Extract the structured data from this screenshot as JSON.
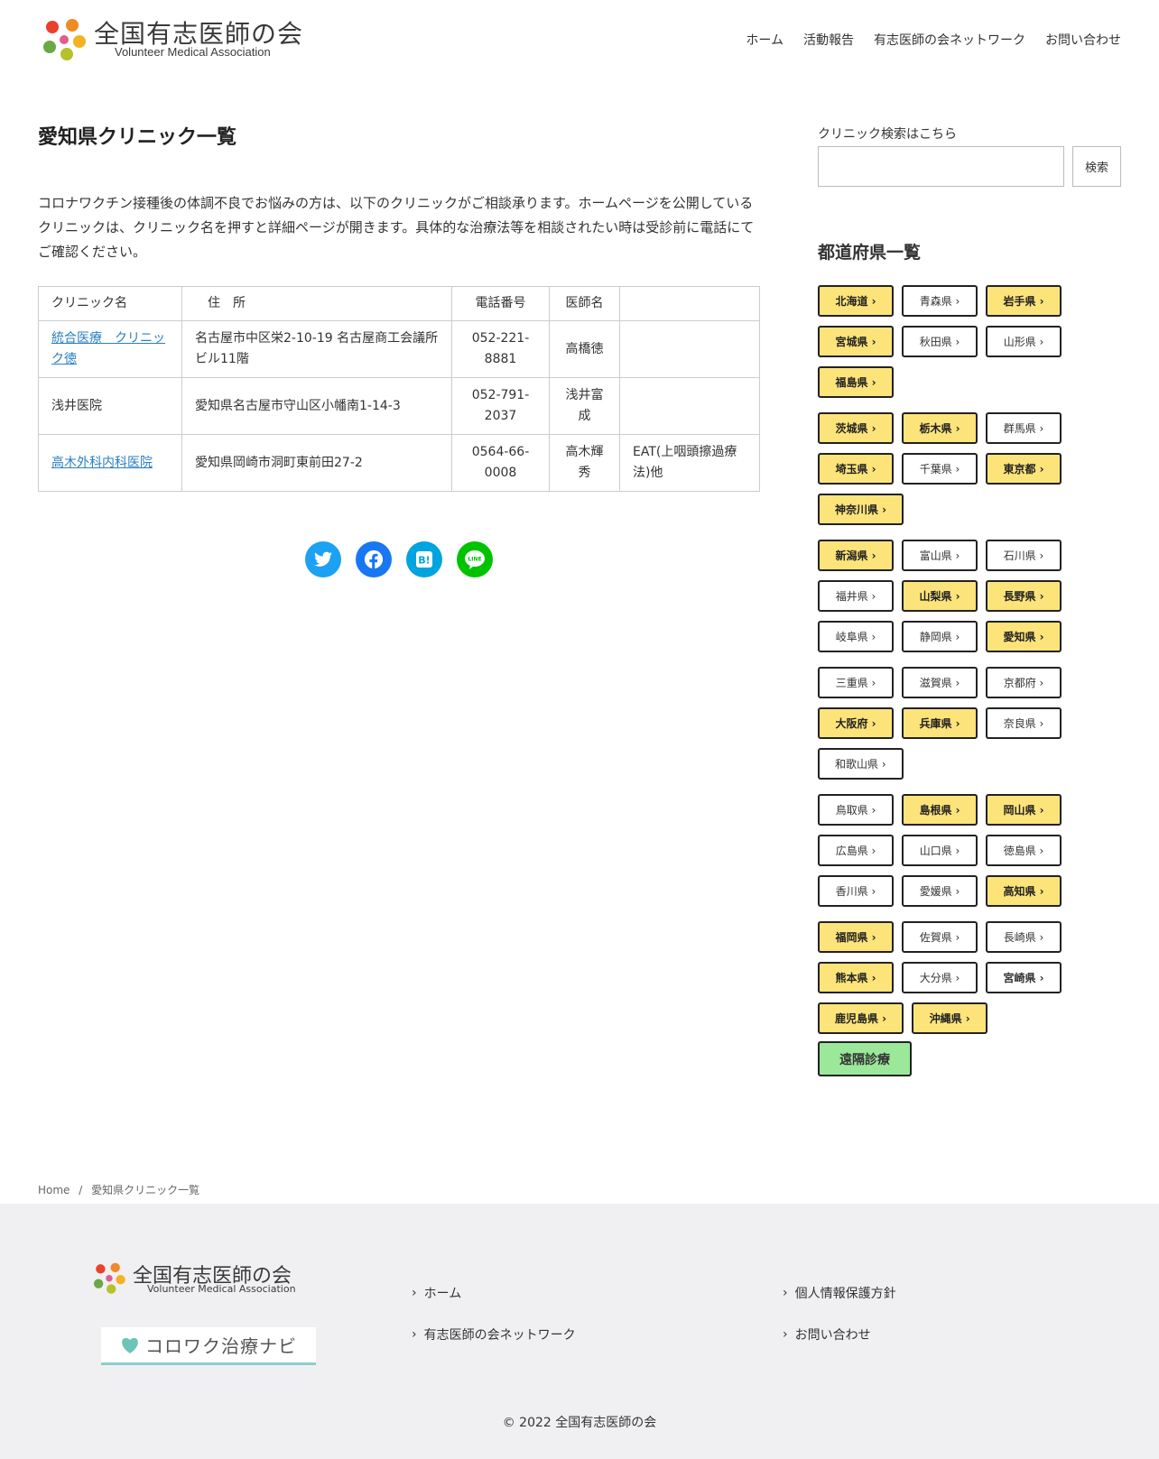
{
  "header": {
    "logo_ja": "全国有志医師の会",
    "logo_en": "Volunteer Medical Association",
    "nav": [
      "ホーム",
      "活動報告",
      "有志医師の会ネットワーク",
      "お問い合わせ"
    ]
  },
  "main": {
    "title": "愛知県クリニック一覧",
    "intro": "コロナワクチン接種後の体調不良でお悩みの方は、以下のクリニックがご相談承ります。ホームページを公開しているクリニックは、クリニック名を押すと詳細ページが開きます。具体的な治療法等を相談されたい時は受診前に電話にてご確認ください。",
    "table": {
      "headers": [
        "クリニック名",
        "住　所",
        "電話番号",
        "医師名",
        ""
      ],
      "rows": [
        {
          "name": "統合医療　クリニック徳",
          "link": true,
          "address": "名古屋市中区栄2-10-19 名古屋商工会議所ビル11階",
          "phone": "052-221-8881",
          "doctor": "高橋徳",
          "note": ""
        },
        {
          "name": "浅井医院",
          "link": false,
          "address": "愛知県名古屋市守山区小幡南1-14-3",
          "phone": "052-791-2037",
          "doctor": "浅井富成",
          "note": ""
        },
        {
          "name": "高木外科内科医院",
          "link": true,
          "address": "愛知県岡崎市洞町東前田27-2",
          "phone": "0564-66-0008",
          "doctor": "高木輝秀",
          "note": "EAT(上咽頭擦過療法)他"
        }
      ]
    },
    "share": [
      {
        "icon": "twitter-icon",
        "color": "#1da1f2"
      },
      {
        "icon": "facebook-icon",
        "color": "#1877f2"
      },
      {
        "icon": "hatena-bookmark-icon",
        "color": "#00a4de"
      },
      {
        "icon": "line-icon",
        "color": "#00c300"
      }
    ]
  },
  "sidebar": {
    "search_label": "クリニック検索はこちら",
    "search_button": "検索",
    "pref_title": "都道府県一覧",
    "groups": [
      [
        {
          "label": "北海道 ›",
          "hl": true
        },
        {
          "label": "青森県 ›",
          "hl": false
        },
        {
          "label": "岩手県 ›",
          "hl": true
        },
        {
          "label": "宮城県 ›",
          "hl": true
        },
        {
          "label": "秋田県 ›",
          "hl": false
        },
        {
          "label": "山形県 ›",
          "hl": false
        },
        {
          "label": "福島県 ›",
          "hl": true
        }
      ],
      [
        {
          "label": "茨城県 ›",
          "hl": true
        },
        {
          "label": "栃木県 ›",
          "hl": true
        },
        {
          "label": "群馬県 ›",
          "hl": false
        },
        {
          "label": "埼玉県 ›",
          "hl": true
        },
        {
          "label": "千葉県 ›",
          "hl": false
        },
        {
          "label": "東京都 ›",
          "hl": true
        },
        {
          "label": "神奈川県 ›",
          "hl": true
        }
      ],
      [
        {
          "label": "新潟県 ›",
          "hl": true
        },
        {
          "label": "富山県 ›",
          "hl": false
        },
        {
          "label": "石川県 ›",
          "hl": false
        },
        {
          "label": "福井県 ›",
          "hl": false
        },
        {
          "label": "山梨県 ›",
          "hl": true
        },
        {
          "label": "長野県 ›",
          "hl": true
        },
        {
          "label": "岐阜県 ›",
          "hl": false
        },
        {
          "label": "静岡県 ›",
          "hl": false
        },
        {
          "label": "愛知県 ›",
          "hl": true
        }
      ],
      [
        {
          "label": "三重県 ›",
          "hl": false
        },
        {
          "label": "滋賀県 ›",
          "hl": false
        },
        {
          "label": "京都府 ›",
          "hl": false
        },
        {
          "label": "大阪府 ›",
          "hl": true
        },
        {
          "label": "兵庫県 ›",
          "hl": true
        },
        {
          "label": "奈良県 ›",
          "hl": false
        },
        {
          "label": "和歌山県 ›",
          "hl": false
        }
      ],
      [
        {
          "label": "鳥取県 ›",
          "hl": false
        },
        {
          "label": "島根県 ›",
          "hl": true
        },
        {
          "label": "岡山県 ›",
          "hl": true
        },
        {
          "label": "広島県 ›",
          "hl": false
        },
        {
          "label": "山口県 ›",
          "hl": false
        },
        {
          "label": "徳島県 ›",
          "hl": false
        },
        {
          "label": "香川県 ›",
          "hl": false
        },
        {
          "label": "愛媛県 ›",
          "hl": false
        },
        {
          "label": "高知県 ›",
          "hl": true
        }
      ],
      [
        {
          "label": "福岡県 ›",
          "hl": true
        },
        {
          "label": "佐賀県 ›",
          "hl": false
        },
        {
          "label": "長崎県 ›",
          "hl": false
        },
        {
          "label": "熊本県 ›",
          "hl": true
        },
        {
          "label": "大分県 ›",
          "hl": false
        },
        {
          "label": "宮崎県 ›",
          "hl": false,
          "bold": true
        },
        {
          "label": "鹿児島県 ›",
          "hl": true
        },
        {
          "label": "沖縄県 ›",
          "hl": true
        },
        {
          "label": "遠隔診療",
          "remote": true
        }
      ]
    ]
  },
  "breadcrumb": {
    "home": "Home",
    "sep": "/",
    "current": "愛知県クリニック一覧"
  },
  "footer": {
    "logo_ja": "全国有志医師の会",
    "logo_en": "Volunteer Medical Association",
    "banner_text": "コロワク治療ナビ",
    "links": [
      "ホーム",
      "個人情報保護方針",
      "有志医師の会ネットワーク",
      "お問い合わせ"
    ],
    "copyright": "© 2022 全国有志医師の会"
  }
}
